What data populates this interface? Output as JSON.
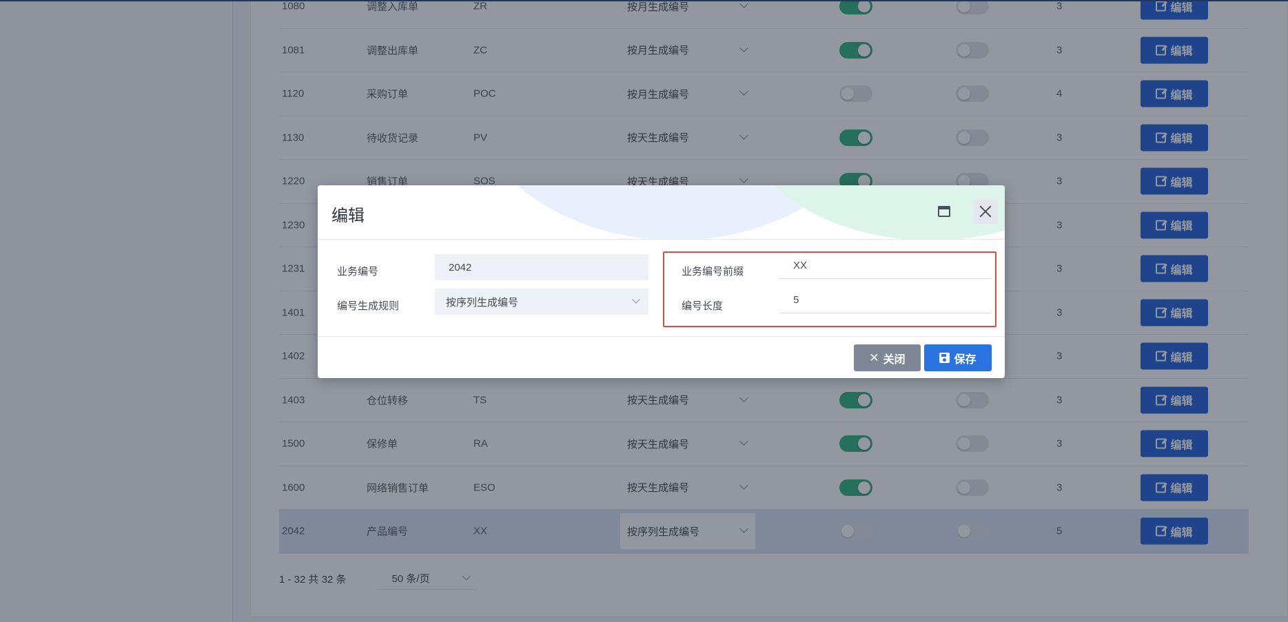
{
  "table": {
    "rows": [
      {
        "id": "1080",
        "name": "调整入库单",
        "prefix": "ZR",
        "rule": "按月生成编号",
        "toggle1": true,
        "toggle2": false,
        "length": "3",
        "action": "编辑"
      },
      {
        "id": "1081",
        "name": "调整出库单",
        "prefix": "ZC",
        "rule": "按月生成编号",
        "toggle1": true,
        "toggle2": false,
        "length": "3",
        "action": "编辑"
      },
      {
        "id": "1120",
        "name": "采购订单",
        "prefix": "POC",
        "rule": "按月生成编号",
        "toggle1": false,
        "toggle2": false,
        "length": "4",
        "action": "编辑"
      },
      {
        "id": "1130",
        "name": "待收货记录",
        "prefix": "PV",
        "rule": "按天生成编号",
        "toggle1": true,
        "toggle2": false,
        "length": "3",
        "action": "编辑"
      },
      {
        "id": "1220",
        "name": "销售订单",
        "prefix": "SOS",
        "rule": "按天生成编号",
        "toggle1": true,
        "toggle2": false,
        "length": "3",
        "action": "编辑"
      },
      {
        "id": "1230",
        "name": "",
        "prefix": "",
        "rule": "",
        "toggle1": null,
        "toggle2": null,
        "length": "3",
        "action": "编辑"
      },
      {
        "id": "1231",
        "name": "",
        "prefix": "",
        "rule": "",
        "toggle1": null,
        "toggle2": null,
        "length": "3",
        "action": "编辑"
      },
      {
        "id": "1401",
        "name": "",
        "prefix": "",
        "rule": "",
        "toggle1": null,
        "toggle2": null,
        "length": "3",
        "action": "编辑"
      },
      {
        "id": "1402",
        "name": "",
        "prefix": "",
        "rule": "",
        "toggle1": null,
        "toggle2": null,
        "length": "3",
        "action": "编辑"
      },
      {
        "id": "1403",
        "name": "仓位转移",
        "prefix": "TS",
        "rule": "按天生成编号",
        "toggle1": true,
        "toggle2": false,
        "length": "3",
        "action": "编辑"
      },
      {
        "id": "1500",
        "name": "保修单",
        "prefix": "RA",
        "rule": "按天生成编号",
        "toggle1": true,
        "toggle2": false,
        "length": "3",
        "action": "编辑"
      },
      {
        "id": "1600",
        "name": "网络销售订单",
        "prefix": "ESO",
        "rule": "按天生成编号",
        "toggle1": true,
        "toggle2": false,
        "length": "3",
        "action": "编辑"
      },
      {
        "id": "2042",
        "name": "产品编号",
        "prefix": "XX",
        "rule": "按序列生成编号",
        "toggle1": false,
        "toggle2": false,
        "length": "5",
        "action": "编辑",
        "highlighted": true
      }
    ]
  },
  "pager": {
    "summary": "1 - 32 共 32 条",
    "page_size": "50 条/页"
  },
  "modal": {
    "title": "编辑",
    "fields": {
      "biz_no_label": "业务编号",
      "biz_no_value": "2042",
      "rule_label": "编号生成规则",
      "rule_value": "按序列生成编号",
      "prefix_label": "业务编号前缀",
      "prefix_value": "XX",
      "length_label": "编号长度",
      "length_value": "5"
    },
    "close_label": "关闭",
    "save_label": "保存"
  },
  "colors": {
    "primary": "#2a65d9",
    "toggle_on": "#36b37e",
    "highlight_box": "#e04a3f",
    "close_button": "#7e8795"
  }
}
